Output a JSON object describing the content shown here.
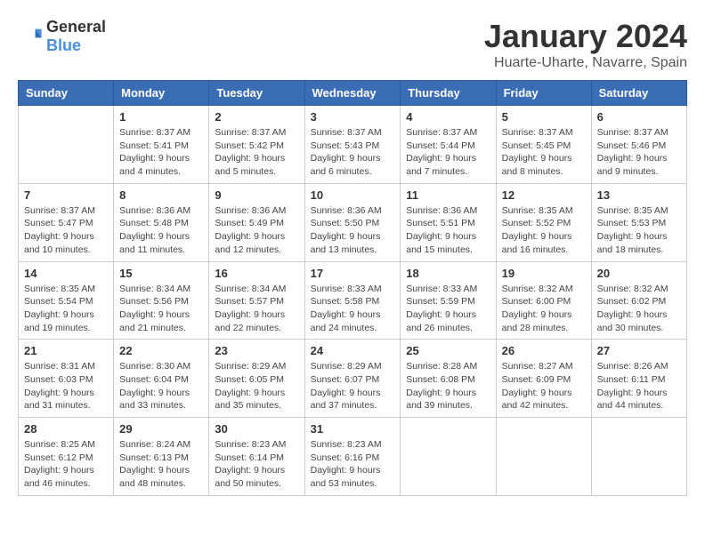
{
  "logo": {
    "general": "General",
    "blue": "Blue"
  },
  "title": "January 2024",
  "subtitle": "Huarte-Uharte, Navarre, Spain",
  "days_of_week": [
    "Sunday",
    "Monday",
    "Tuesday",
    "Wednesday",
    "Thursday",
    "Friday",
    "Saturday"
  ],
  "weeks": [
    [
      {
        "day": "",
        "info": ""
      },
      {
        "day": "1",
        "info": "Sunrise: 8:37 AM\nSunset: 5:41 PM\nDaylight: 9 hours\nand 4 minutes."
      },
      {
        "day": "2",
        "info": "Sunrise: 8:37 AM\nSunset: 5:42 PM\nDaylight: 9 hours\nand 5 minutes."
      },
      {
        "day": "3",
        "info": "Sunrise: 8:37 AM\nSunset: 5:43 PM\nDaylight: 9 hours\nand 6 minutes."
      },
      {
        "day": "4",
        "info": "Sunrise: 8:37 AM\nSunset: 5:44 PM\nDaylight: 9 hours\nand 7 minutes."
      },
      {
        "day": "5",
        "info": "Sunrise: 8:37 AM\nSunset: 5:45 PM\nDaylight: 9 hours\nand 8 minutes."
      },
      {
        "day": "6",
        "info": "Sunrise: 8:37 AM\nSunset: 5:46 PM\nDaylight: 9 hours\nand 9 minutes."
      }
    ],
    [
      {
        "day": "7",
        "info": "Sunrise: 8:37 AM\nSunset: 5:47 PM\nDaylight: 9 hours\nand 10 minutes."
      },
      {
        "day": "8",
        "info": "Sunrise: 8:36 AM\nSunset: 5:48 PM\nDaylight: 9 hours\nand 11 minutes."
      },
      {
        "day": "9",
        "info": "Sunrise: 8:36 AM\nSunset: 5:49 PM\nDaylight: 9 hours\nand 12 minutes."
      },
      {
        "day": "10",
        "info": "Sunrise: 8:36 AM\nSunset: 5:50 PM\nDaylight: 9 hours\nand 13 minutes."
      },
      {
        "day": "11",
        "info": "Sunrise: 8:36 AM\nSunset: 5:51 PM\nDaylight: 9 hours\nand 15 minutes."
      },
      {
        "day": "12",
        "info": "Sunrise: 8:35 AM\nSunset: 5:52 PM\nDaylight: 9 hours\nand 16 minutes."
      },
      {
        "day": "13",
        "info": "Sunrise: 8:35 AM\nSunset: 5:53 PM\nDaylight: 9 hours\nand 18 minutes."
      }
    ],
    [
      {
        "day": "14",
        "info": "Sunrise: 8:35 AM\nSunset: 5:54 PM\nDaylight: 9 hours\nand 19 minutes."
      },
      {
        "day": "15",
        "info": "Sunrise: 8:34 AM\nSunset: 5:56 PM\nDaylight: 9 hours\nand 21 minutes."
      },
      {
        "day": "16",
        "info": "Sunrise: 8:34 AM\nSunset: 5:57 PM\nDaylight: 9 hours\nand 22 minutes."
      },
      {
        "day": "17",
        "info": "Sunrise: 8:33 AM\nSunset: 5:58 PM\nDaylight: 9 hours\nand 24 minutes."
      },
      {
        "day": "18",
        "info": "Sunrise: 8:33 AM\nSunset: 5:59 PM\nDaylight: 9 hours\nand 26 minutes."
      },
      {
        "day": "19",
        "info": "Sunrise: 8:32 AM\nSunset: 6:00 PM\nDaylight: 9 hours\nand 28 minutes."
      },
      {
        "day": "20",
        "info": "Sunrise: 8:32 AM\nSunset: 6:02 PM\nDaylight: 9 hours\nand 30 minutes."
      }
    ],
    [
      {
        "day": "21",
        "info": "Sunrise: 8:31 AM\nSunset: 6:03 PM\nDaylight: 9 hours\nand 31 minutes."
      },
      {
        "day": "22",
        "info": "Sunrise: 8:30 AM\nSunset: 6:04 PM\nDaylight: 9 hours\nand 33 minutes."
      },
      {
        "day": "23",
        "info": "Sunrise: 8:29 AM\nSunset: 6:05 PM\nDaylight: 9 hours\nand 35 minutes."
      },
      {
        "day": "24",
        "info": "Sunrise: 8:29 AM\nSunset: 6:07 PM\nDaylight: 9 hours\nand 37 minutes."
      },
      {
        "day": "25",
        "info": "Sunrise: 8:28 AM\nSunset: 6:08 PM\nDaylight: 9 hours\nand 39 minutes."
      },
      {
        "day": "26",
        "info": "Sunrise: 8:27 AM\nSunset: 6:09 PM\nDaylight: 9 hours\nand 42 minutes."
      },
      {
        "day": "27",
        "info": "Sunrise: 8:26 AM\nSunset: 6:11 PM\nDaylight: 9 hours\nand 44 minutes."
      }
    ],
    [
      {
        "day": "28",
        "info": "Sunrise: 8:25 AM\nSunset: 6:12 PM\nDaylight: 9 hours\nand 46 minutes."
      },
      {
        "day": "29",
        "info": "Sunrise: 8:24 AM\nSunset: 6:13 PM\nDaylight: 9 hours\nand 48 minutes."
      },
      {
        "day": "30",
        "info": "Sunrise: 8:23 AM\nSunset: 6:14 PM\nDaylight: 9 hours\nand 50 minutes."
      },
      {
        "day": "31",
        "info": "Sunrise: 8:23 AM\nSunset: 6:16 PM\nDaylight: 9 hours\nand 53 minutes."
      },
      {
        "day": "",
        "info": ""
      },
      {
        "day": "",
        "info": ""
      },
      {
        "day": "",
        "info": ""
      }
    ]
  ]
}
